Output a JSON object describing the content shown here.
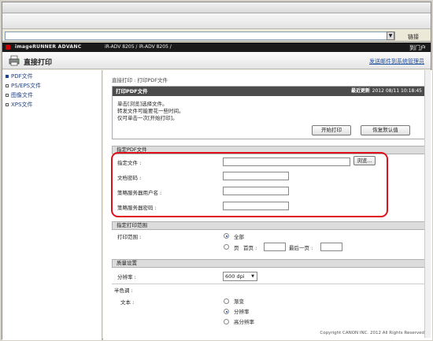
{
  "browser": {
    "links_label": "链接"
  },
  "header": {
    "product": "imageRUNNER ADVANC",
    "model": "iR-ADV 8205 / iR-ADV 8205 /",
    "logout": "到门户"
  },
  "title": {
    "text": "直接打印",
    "admin_link": "发送邮件到系统管理员"
  },
  "sidebar": {
    "items": [
      {
        "label": "PDF文件",
        "active": true
      },
      {
        "label": "PS/EPS文件",
        "active": false
      },
      {
        "label": "图像文件",
        "active": false
      },
      {
        "label": "XPS文件",
        "active": false
      }
    ]
  },
  "breadcrumb": "直接打印 : 打印PDF文件",
  "print_panel": {
    "title": "打印PDF文件",
    "last_updated_label": "最近更新",
    "last_updated": "2012 08/11 10:18:45",
    "instructions": [
      "单击[浏览]选择文件。",
      "转发文件可能要花一些时间。",
      "仅可单击一次[开始打印]。"
    ],
    "start_button": "开始打印",
    "reset_button": "恢复默认值"
  },
  "specify_file": {
    "section_title": "指定PDF文件",
    "file_label": "指定文件 :",
    "browse_button": "浏览...",
    "doc_password_label": "文档密码 :",
    "policy_user_label": "策略服务器用户名 :",
    "policy_password_label": "策略服务器密码 :"
  },
  "print_range": {
    "section_title": "指定打印范围",
    "label": "打印范围 :",
    "option_all": "全部",
    "option_pages": "页",
    "first_page_label": "首页 :",
    "last_page_label": "最后一页 :"
  },
  "quality": {
    "section_title": "质量设置",
    "resolution_label": "分辨率 :",
    "resolution_value": "600 dpi",
    "halftone_label": "半色调 :",
    "text_label": "文本 :",
    "options": [
      "渐变",
      "分辨率",
      "高分辨率"
    ],
    "selected_index": 1
  },
  "footer": "Copyright CANON INC. 2012 All Rights Reserved"
}
